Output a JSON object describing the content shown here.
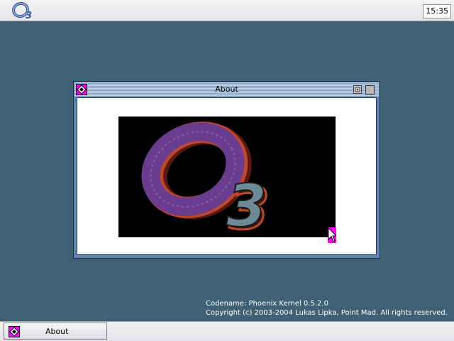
{
  "menubar": {
    "logo_icon": "o3-logo-icon",
    "clock": "15:35"
  },
  "window": {
    "title": "About",
    "menu_icon": "window-menu-icon",
    "iconify_icon": "iconify-icon",
    "close_icon": "close-icon",
    "banner_icon": "o3-banner-logo"
  },
  "info": {
    "codename": "Codename: Phoenix Kernel 0.5.2.0",
    "copyright": "Copyright (c) 2003-2004 Lukas Lipka, Point Mad. All rights reserved."
  },
  "taskbar": {
    "items": [
      {
        "label": "About",
        "icon": "window-menu-icon"
      }
    ]
  },
  "colors": {
    "desktop": "#3f6075",
    "accent": "#ff00ff",
    "logo_purple": "#6a3d8f",
    "logo_teal": "#6d8b97"
  }
}
